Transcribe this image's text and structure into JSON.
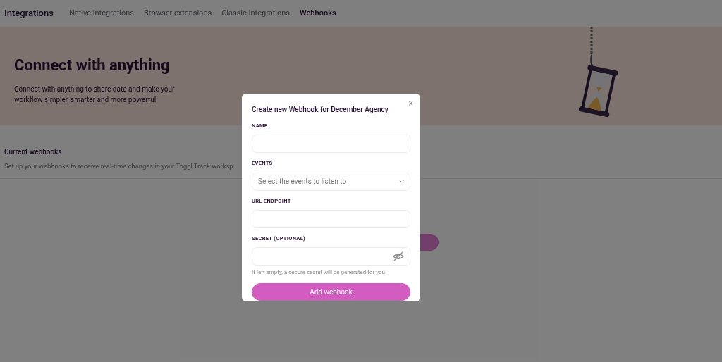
{
  "header": {
    "title": "Integrations",
    "tabs": [
      {
        "label": "Native integrations",
        "selected": false
      },
      {
        "label": "Browser extensions",
        "selected": false
      },
      {
        "label": "Classic Integrations",
        "selected": false
      },
      {
        "label": "Webhooks",
        "selected": true
      }
    ]
  },
  "hero": {
    "title": "Connect with anything",
    "text": "Connect with anything to share data and make your workflow simpler, smarter and more powerful"
  },
  "section": {
    "title": "Current webhooks",
    "text": "Set up your webhooks to receive real-time changes in your Toggl Track worksp"
  },
  "dialog": {
    "title": "Create new Webhook for December Agency",
    "close": "×",
    "fields": [
      {
        "label": "NAME",
        "kind": "text"
      },
      {
        "label": "EVENTS",
        "kind": "select",
        "placeholder": "Select the events to listen to"
      },
      {
        "label": "URL ENDPOINT",
        "kind": "text"
      },
      {
        "label": "SECRET (OPTIONAL)",
        "kind": "secret",
        "hint": "If left empty, a secure secret will be generated for you"
      }
    ],
    "button": "Add webhook"
  }
}
